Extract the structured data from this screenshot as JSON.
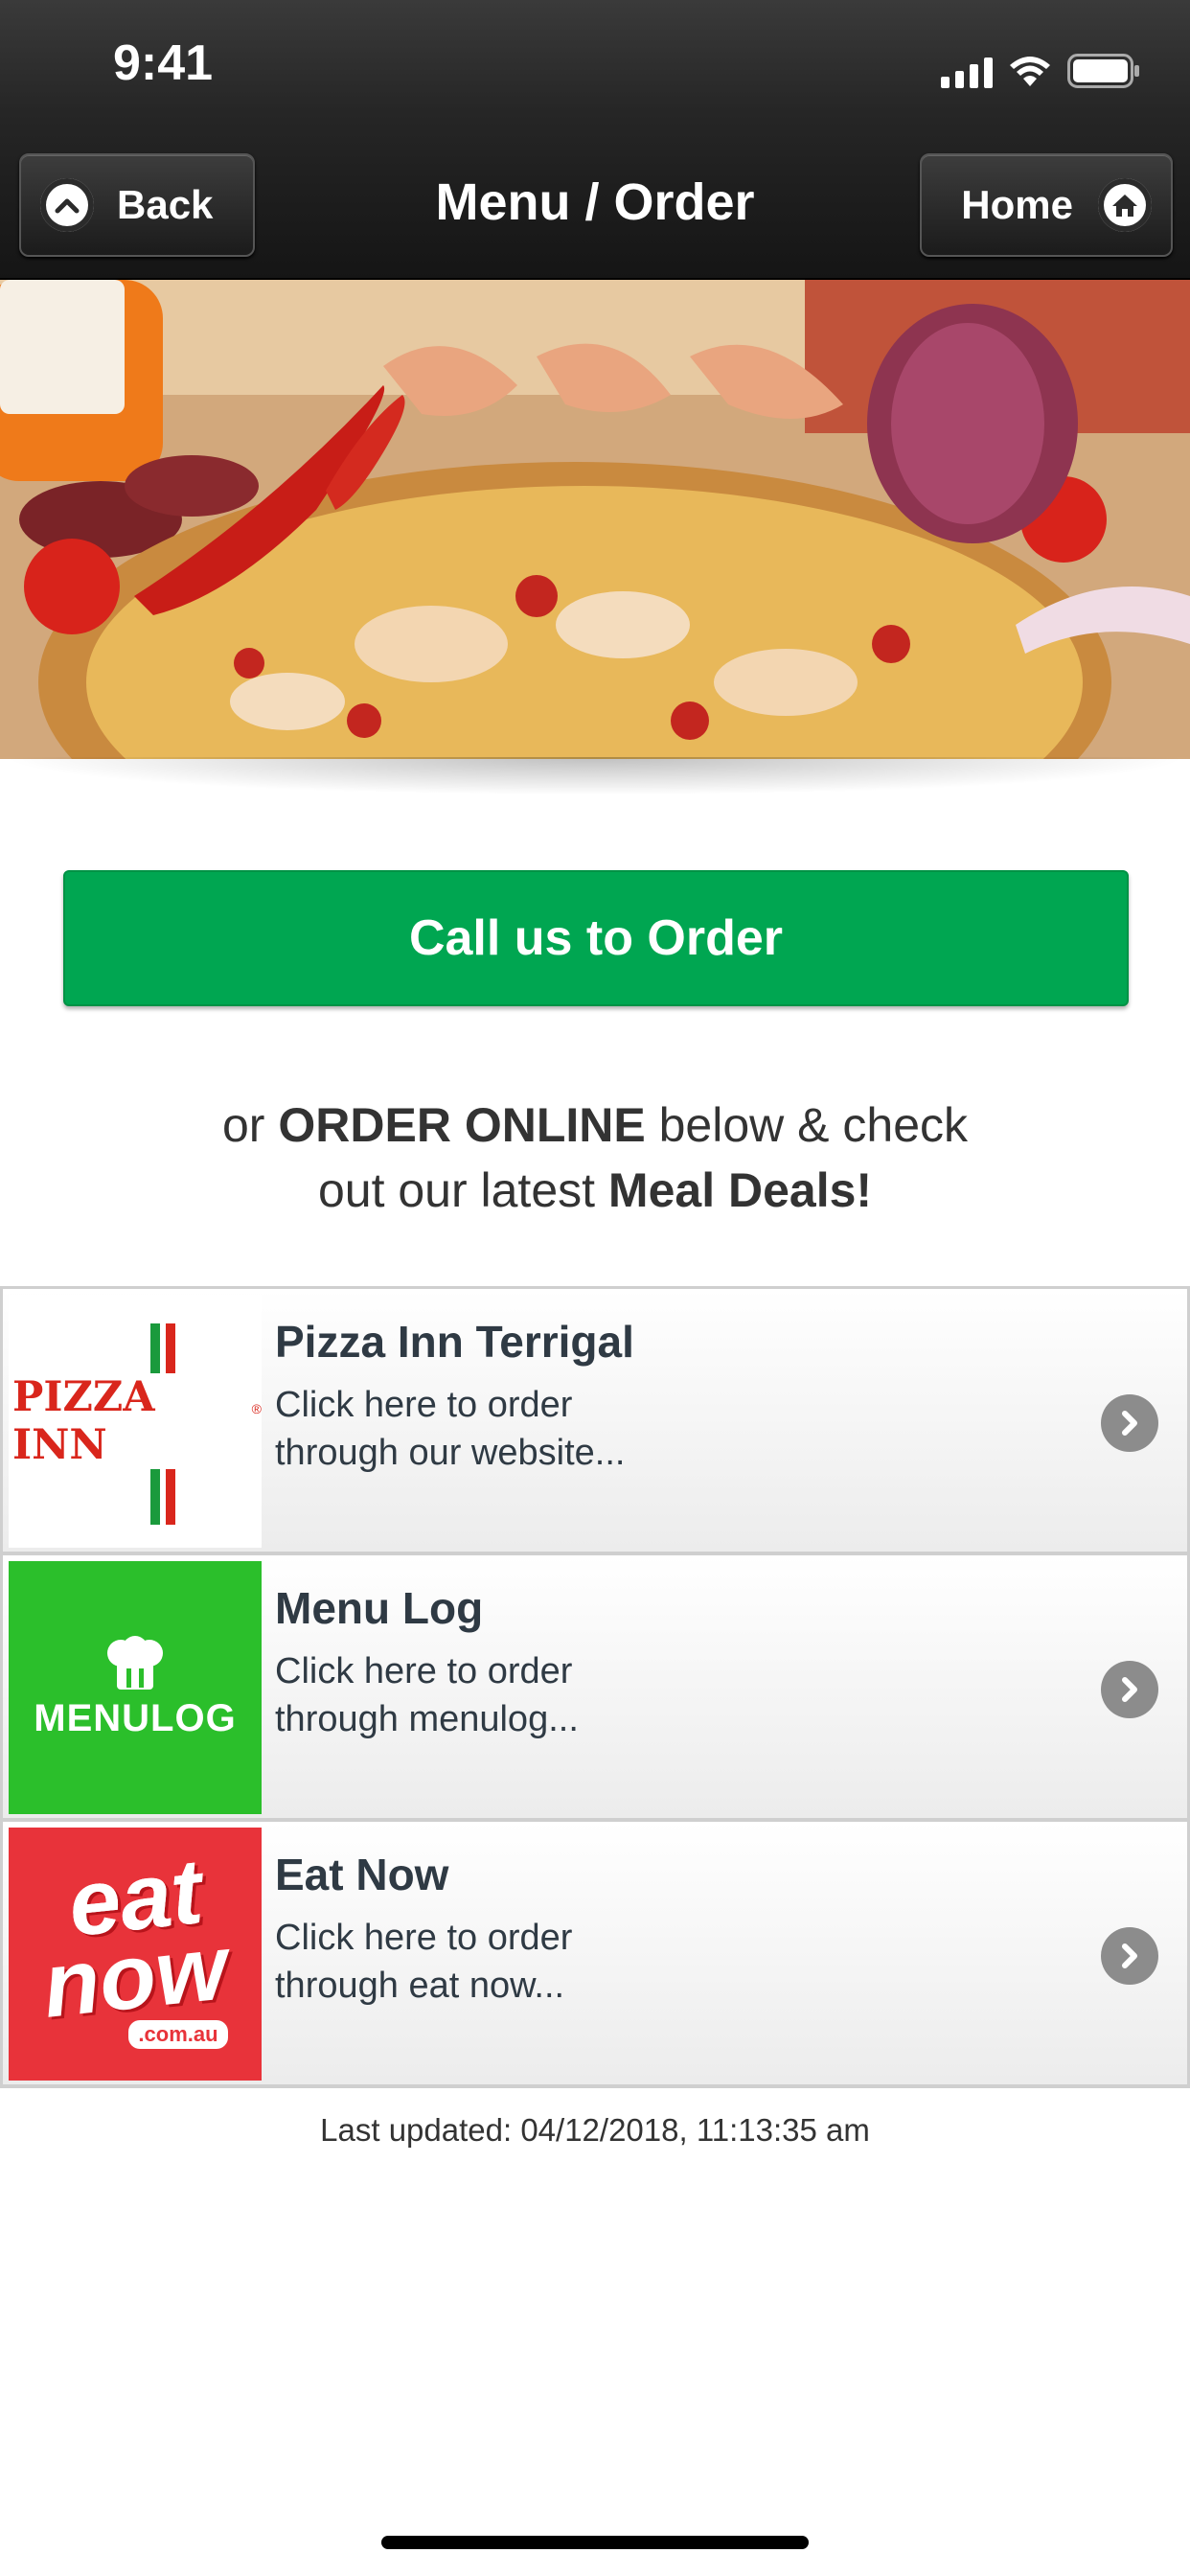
{
  "status_bar": {
    "time": "9:41",
    "icons": [
      "signal-icon",
      "wifi-icon",
      "battery-icon"
    ]
  },
  "nav": {
    "back_label": "Back",
    "title": "Menu / Order",
    "home_label": "Home"
  },
  "hero": {
    "image": "pizza with prawns, chillies and red onion"
  },
  "cta": {
    "label": "Call us to Order",
    "color": "#00a651"
  },
  "promo": {
    "part1": "or ",
    "bold1": "ORDER ONLINE",
    "part2": " below & check",
    "part3": "out our latest ",
    "bold2": "Meal Deals!"
  },
  "order_options": [
    {
      "title": "Pizza Inn Terrigal",
      "line1": "Click here to order",
      "line2": "through our website...",
      "logo_text": "PIZZA INN",
      "logo_mark": "®"
    },
    {
      "title": "Menu Log",
      "line1": "Click here to order",
      "line2": "through menulog...",
      "logo_text": "MENULOG",
      "logo_color": "#2bbf2b"
    },
    {
      "title": "Eat Now",
      "line1": "Click here to order",
      "line2": "through eat now...",
      "logo_text_top": "eat",
      "logo_text_bottom": "now",
      "logo_sub": ".com.au",
      "logo_color": "#e8333a"
    }
  ],
  "footer": {
    "last_updated": "Last updated: 04/12/2018, 11:13:35 am"
  }
}
